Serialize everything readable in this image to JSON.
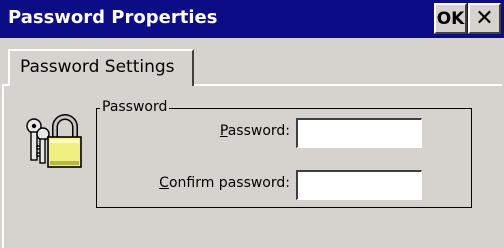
{
  "window": {
    "title": "Password Properties",
    "ok_label": "OK",
    "close_label": "✕"
  },
  "tabs": [
    {
      "label": "Password Settings",
      "active": true
    }
  ],
  "group": {
    "title": "Password",
    "password_label": {
      "pre": "",
      "mnemonic": "P",
      "post": "assword:"
    },
    "password_value": "",
    "confirm_label": {
      "pre": "",
      "mnemonic": "C",
      "post": "onfirm password:"
    },
    "confirm_value": ""
  },
  "icons": {
    "main": "keys-lock-icon"
  },
  "colors": {
    "titlebar": "#0c0d86",
    "background": "#d6d3ce",
    "lock_body": "#f0f080"
  }
}
